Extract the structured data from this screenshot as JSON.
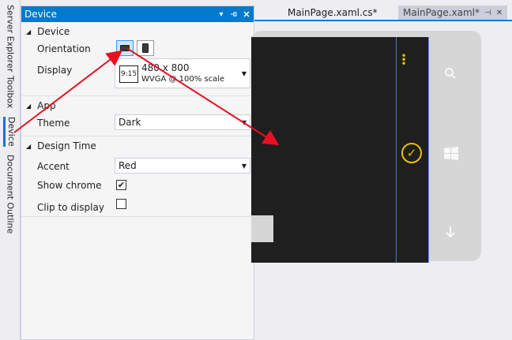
{
  "side_tabs": [
    "Server Explorer",
    "Toolbox",
    "Device",
    "Document Outline"
  ],
  "panel": {
    "title": "Device",
    "pin_icon": "pin-icon",
    "close_icon": "close-icon",
    "sections": {
      "device": {
        "title": "Device",
        "orientation_label": "Orientation",
        "display_label": "Display",
        "display_value": "480 x 800",
        "display_sub": "WVGA @ 100% scale",
        "display_icon_text": "9:15"
      },
      "app": {
        "title": "App",
        "theme_label": "Theme",
        "theme_value": "Dark"
      },
      "design_time": {
        "title": "Design Time",
        "accent_label": "Accent",
        "accent_value": "Red",
        "show_chrome_label": "Show chrome",
        "show_chrome_checked": true,
        "clip_label": "Clip to display",
        "clip_checked": false
      }
    }
  },
  "tabs": [
    {
      "label": "MainPage.xaml.cs*"
    },
    {
      "label": "MainPage.xaml*"
    }
  ],
  "colors": {
    "accent": "#007acc",
    "phone_accent": "#e8c200",
    "arrow": "#e81123"
  }
}
